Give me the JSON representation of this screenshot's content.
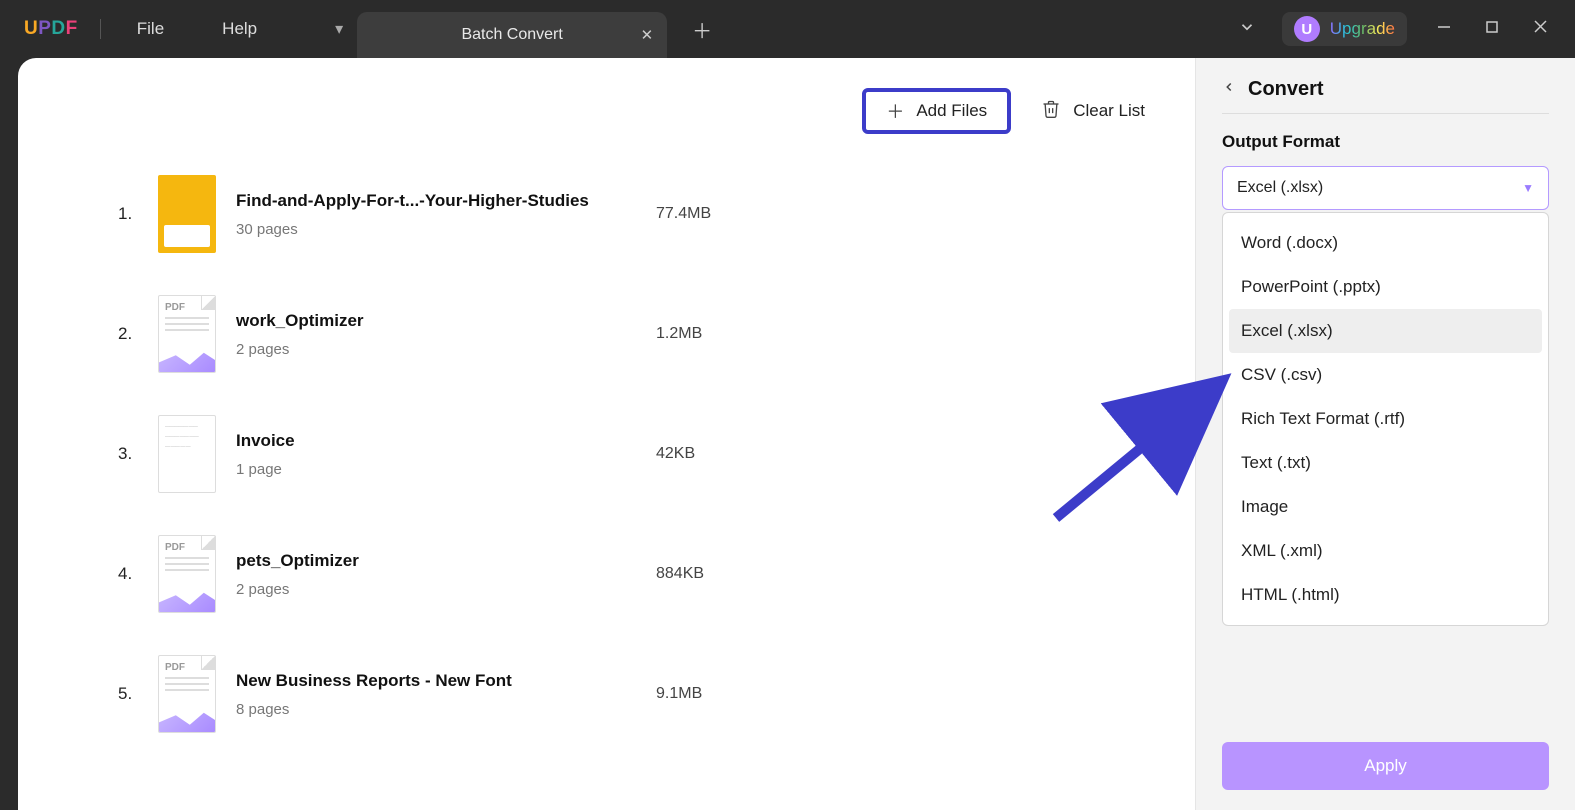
{
  "menu": {
    "file": "File",
    "help": "Help"
  },
  "tab": {
    "title": "Batch Convert"
  },
  "upgrade": {
    "letter": "U",
    "label": "Upgrade"
  },
  "toolbar": {
    "add_files": "Add Files",
    "clear_list": "Clear List"
  },
  "files": [
    {
      "num": "1.",
      "name": "Find-and-Apply-For-t...-Your-Higher-Studies",
      "pages": "30 pages",
      "size": "77.4MB",
      "thumb": "yellow"
    },
    {
      "num": "2.",
      "name": "work_Optimizer",
      "pages": "2 pages",
      "size": "1.2MB",
      "thumb": "pdf"
    },
    {
      "num": "3.",
      "name": "Invoice",
      "pages": "1 page",
      "size": "42KB",
      "thumb": "doc"
    },
    {
      "num": "4.",
      "name": "pets_Optimizer",
      "pages": "2 pages",
      "size": "884KB",
      "thumb": "pdf"
    },
    {
      "num": "5.",
      "name": "New Business Reports - New Font",
      "pages": "8 pages",
      "size": "9.1MB",
      "thumb": "pdf"
    }
  ],
  "panel": {
    "title": "Convert",
    "output_label": "Output Format",
    "selected": "Excel (.xlsx)",
    "options": [
      "Word (.docx)",
      "PowerPoint (.pptx)",
      "Excel (.xlsx)",
      "CSV (.csv)",
      "Rich Text Format (.rtf)",
      "Text (.txt)",
      "Image",
      "XML (.xml)",
      "HTML (.html)"
    ],
    "highlight_index": 2,
    "apply": "Apply"
  }
}
